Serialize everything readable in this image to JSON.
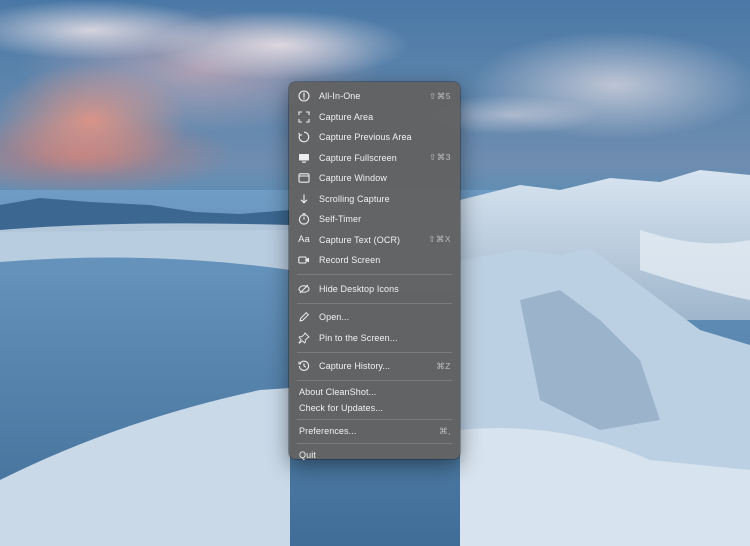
{
  "menu": {
    "items": [
      {
        "label": "All-In-One",
        "shortcut": "⇧⌘5",
        "icon": "all-in-one-icon"
      },
      {
        "label": "Capture Area",
        "shortcut": "",
        "icon": "capture-area-icon"
      },
      {
        "label": "Capture Previous Area",
        "shortcut": "",
        "icon": "previous-area-icon"
      },
      {
        "label": "Capture Fullscreen",
        "shortcut": "⇧⌘3",
        "icon": "fullscreen-monitor-icon"
      },
      {
        "label": "Capture Window",
        "shortcut": "",
        "icon": "window-icon"
      },
      {
        "label": "Scrolling Capture",
        "shortcut": "",
        "icon": "arrow-down-icon"
      },
      {
        "label": "Self-Timer",
        "shortcut": "",
        "icon": "timer-icon"
      },
      {
        "label": "Capture Text (OCR)",
        "shortcut": "⇧⌘X",
        "icon": "text-aa-icon"
      },
      {
        "label": "Record Screen",
        "shortcut": "",
        "icon": "video-camera-icon"
      },
      {
        "label": "Hide Desktop Icons",
        "shortcut": "",
        "icon": "eye-slash-icon"
      },
      {
        "label": "Open...",
        "shortcut": "",
        "icon": "pencil-icon"
      },
      {
        "label": "Pin to the Screen...",
        "shortcut": "",
        "icon": "pin-icon"
      },
      {
        "label": "Capture History...",
        "shortcut": "⌘Z",
        "icon": "history-clock-icon"
      },
      {
        "label": "About CleanShot...",
        "shortcut": ""
      },
      {
        "label": "Check for Updates...",
        "shortcut": ""
      },
      {
        "label": "Preferences...",
        "shortcut": "⌘,"
      },
      {
        "label": "Quit",
        "shortcut": ""
      }
    ]
  }
}
